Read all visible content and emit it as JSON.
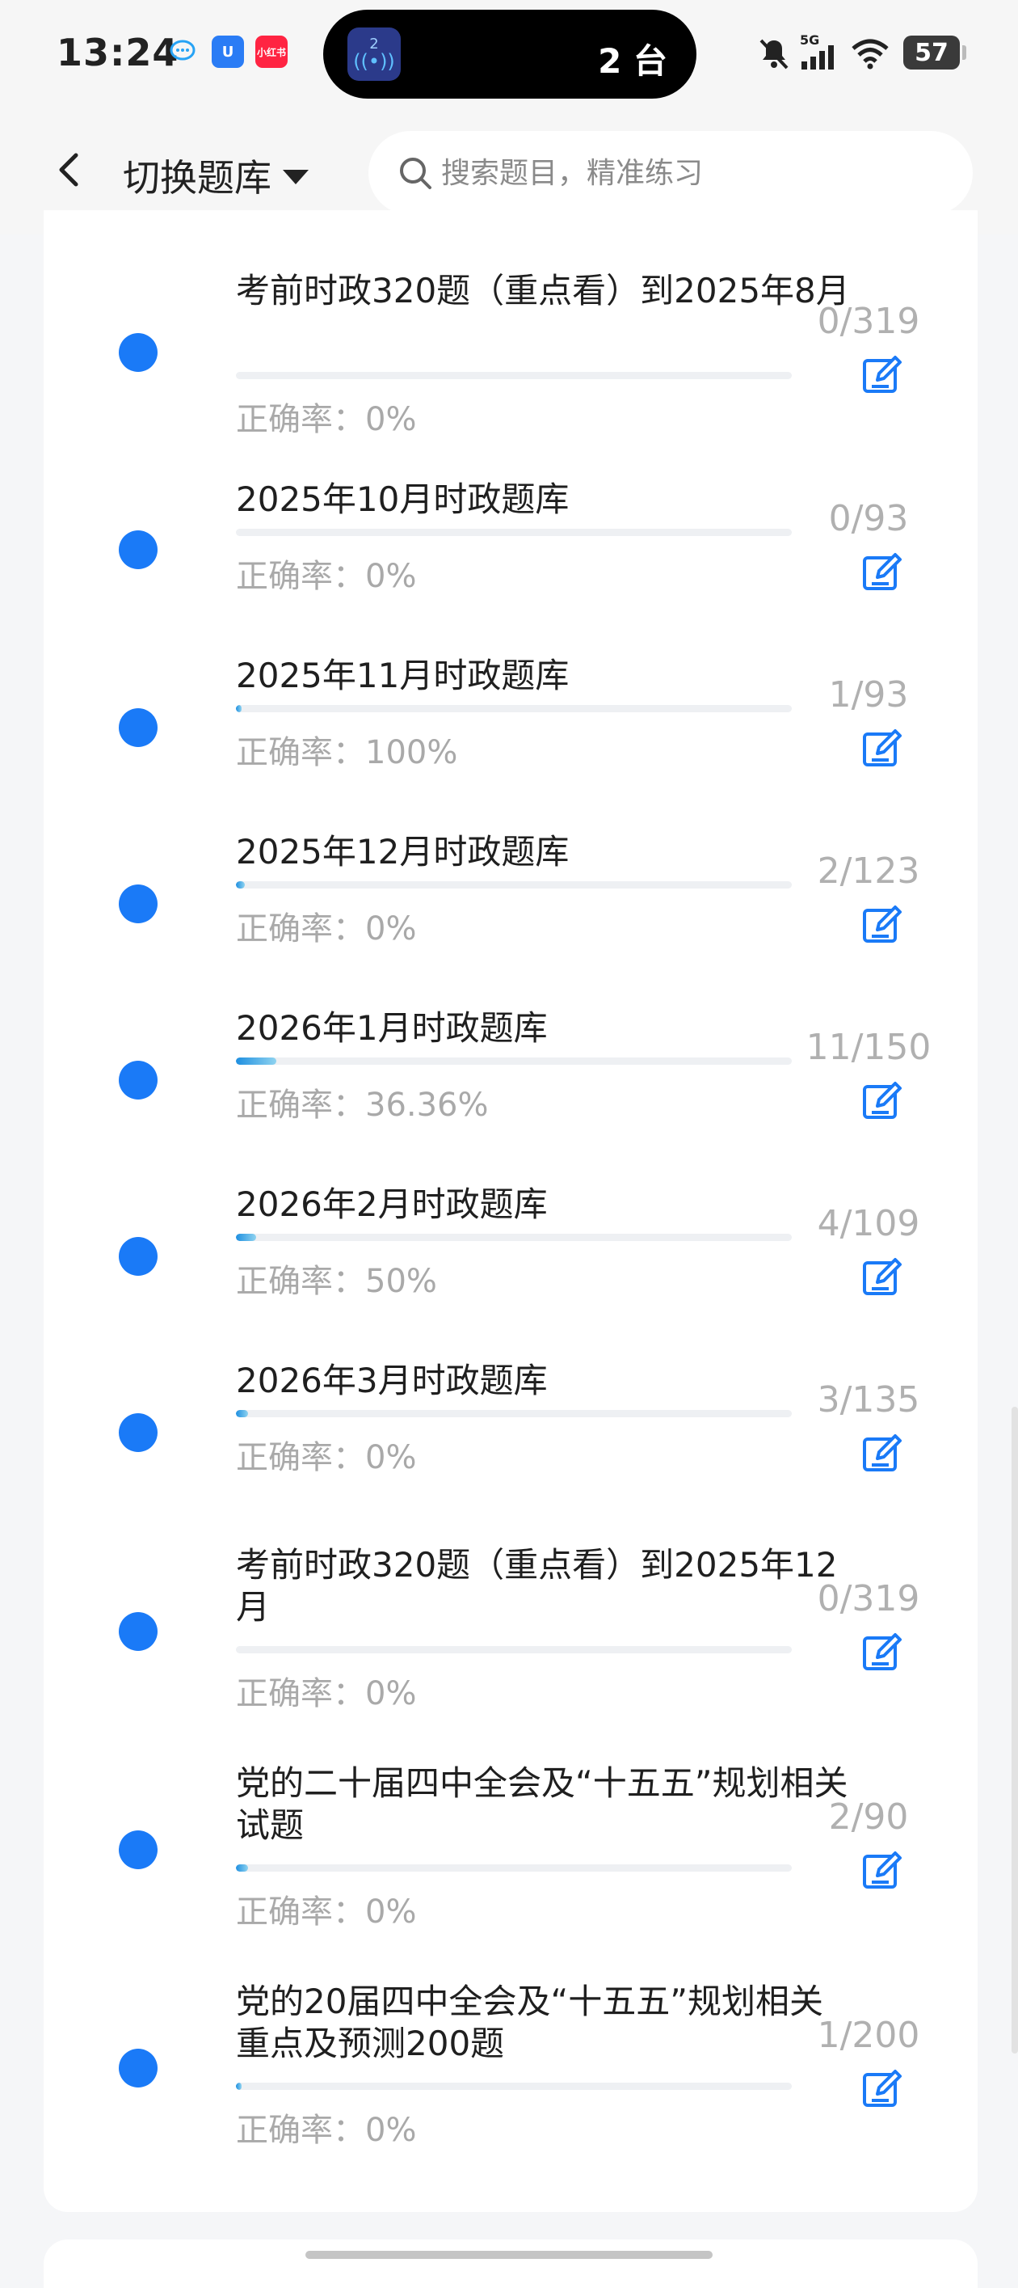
{
  "status": {
    "time": "13:24",
    "pill_app_digit": "2",
    "pill_text": "2 台",
    "battery": "57",
    "signal": "5G"
  },
  "header": {
    "switch_label": "切换题库",
    "search_placeholder": "搜索题目，精准练习"
  },
  "accuracy_prefix": "正确率：",
  "colors": {
    "accent": "#1a7af7",
    "progress": "#1e8fe0"
  },
  "items": [
    {
      "title": "考前时政320题（重点看）到2025年8月",
      "count": "0/319",
      "accuracy": "正确率：0%",
      "progress": 0.0
    },
    {
      "title": "2025年10月时政题库",
      "count": "0/93",
      "accuracy": "正确率：0%",
      "progress": 0.0
    },
    {
      "title": "2025年11月时政题库",
      "count": "1/93",
      "accuracy": "正确率：100%",
      "progress": 0.0108
    },
    {
      "title": "2025年12月时政题库",
      "count": "2/123",
      "accuracy": "正确率：0%",
      "progress": 0.0163
    },
    {
      "title": "2026年1月时政题库",
      "count": "11/150",
      "accuracy": "正确率：36.36%",
      "progress": 0.0733
    },
    {
      "title": "2026年2月时政题库",
      "count": "4/109",
      "accuracy": "正确率：50%",
      "progress": 0.0367
    },
    {
      "title": "2026年3月时政题库",
      "count": "3/135",
      "accuracy": "正确率：0%",
      "progress": 0.0222
    },
    {
      "title": "考前时政320题（重点看）到2025年12月",
      "count": "0/319",
      "accuracy": "正确率：0%",
      "progress": 0.0
    },
    {
      "title": "党的二十届四中全会及“十五五”规划相关试题",
      "count": "2/90",
      "accuracy": "正确率：0%",
      "progress": 0.0222
    },
    {
      "title": "党的20届四中全会及“十五五”规划相关重点及预测200题",
      "count": "1/200",
      "accuracy": "正确率：0%",
      "progress": 0.005
    }
  ]
}
